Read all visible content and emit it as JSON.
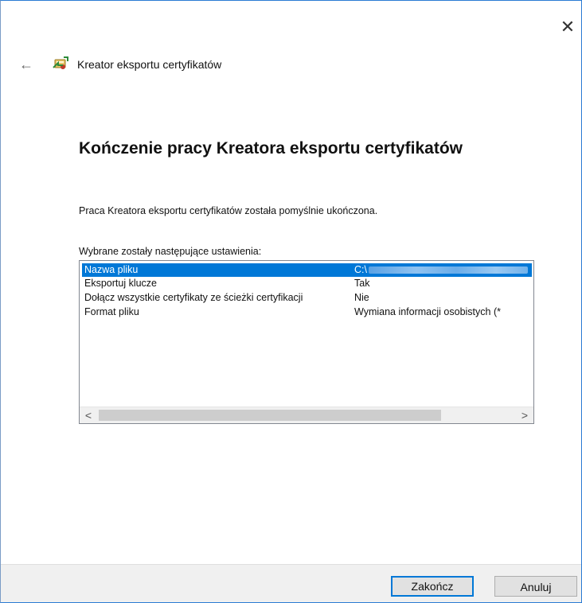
{
  "window": {
    "title": "Kreator eksportu certyfikatów",
    "close_glyph": "✕",
    "back_glyph": "←"
  },
  "heading": "Kończenie pracy Kreatora eksportu certyfikatów",
  "message": "Praca Kreatora eksportu certyfikatów została pomyślnie ukończona.",
  "settings": {
    "label": "Wybrane zostały następujące ustawienia:",
    "rows": [
      {
        "key": "Nazwa pliku",
        "value": "C:\\"
      },
      {
        "key": "Eksportuj klucze",
        "value": "Tak"
      },
      {
        "key": "Dołącz wszystkie certyfikaty ze ścieżki certyfikacji",
        "value": "Nie"
      },
      {
        "key": "Format pliku",
        "value": "Wymiana informacji osobistych (*"
      }
    ],
    "scroll_left": "<",
    "scroll_right": ">"
  },
  "buttons": {
    "finish": "Zakończ",
    "cancel": "Anuluj"
  },
  "colors": {
    "selection": "#0078d7",
    "footer": "#f0f0f0"
  }
}
